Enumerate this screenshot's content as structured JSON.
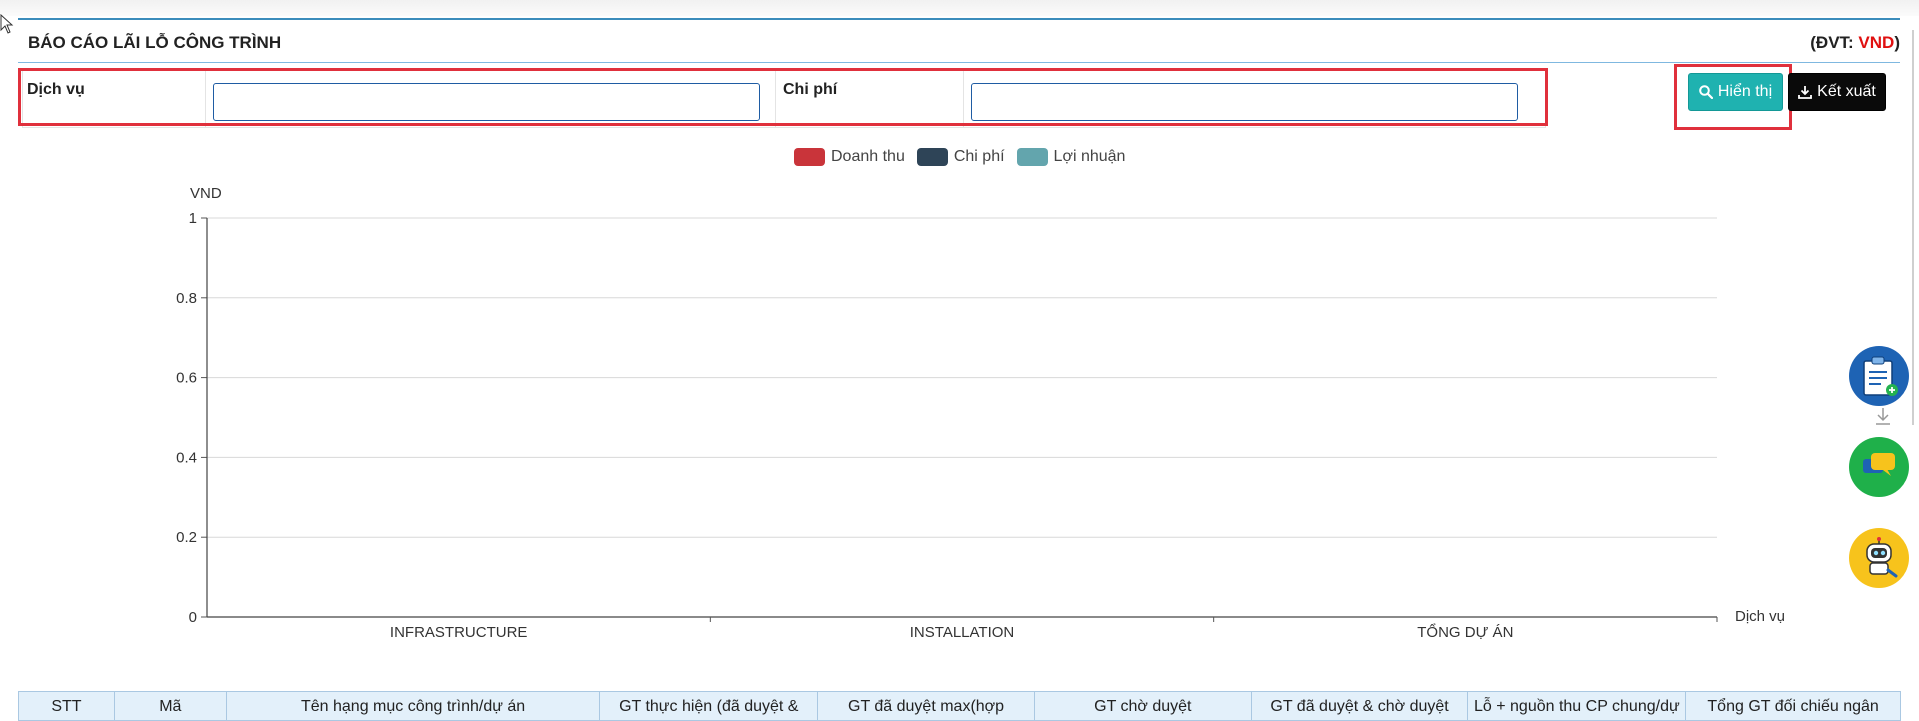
{
  "report": {
    "title": "BÁO CÁO LÃI LỖ CÔNG TRÌNH",
    "unit_prefix": "(ĐVT: ",
    "unit_value": "VND",
    "unit_suffix": ")"
  },
  "filters": {
    "service_label": "Dịch vụ",
    "service_value": "",
    "cost_label": "Chi phí",
    "cost_value": ""
  },
  "buttons": {
    "show_label": "Hiển thị",
    "export_label": "Kết xuất"
  },
  "legend": [
    {
      "name": "Doanh thu",
      "color": "#c9343a"
    },
    {
      "name": "Chi phí",
      "color": "#2e4457"
    },
    {
      "name": "Lợi nhuận",
      "color": "#63a5ad"
    }
  ],
  "chart_data": {
    "type": "bar",
    "categories": [
      "INFRASTRUCTURE",
      "INSTALLATION",
      "TỔNG DỰ ÁN"
    ],
    "series": [
      {
        "name": "Doanh thu",
        "values": [
          0,
          0,
          0
        ]
      },
      {
        "name": "Chi phí",
        "values": [
          0,
          0,
          0
        ]
      },
      {
        "name": "Lợi nhuận",
        "values": [
          0,
          0,
          0
        ]
      }
    ],
    "xlabel": "Dịch vụ",
    "ylabel": "VND",
    "ylim": [
      0,
      1
    ],
    "yticks": [
      "0",
      "0.2",
      "0.4",
      "0.6",
      "0.8",
      "1"
    ],
    "grid": true,
    "legend_position": "top-center"
  },
  "table": {
    "headers": [
      "STT",
      "Mã",
      "Tên hạng mục công trình/dự án",
      "GT thực hiện (đã duyệt &",
      "GT đã duyệt max(hợp",
      "GT chờ duyệt",
      "GT đã duyệt & chờ duyệt",
      "Lỗ + nguồn thu CP chung/dự",
      "Tổng GT đối chiếu ngân"
    ]
  },
  "floating": {
    "clipboard_icon_color": "#1e63b4",
    "chat_icon_color": "#1fb04a",
    "bot_icon_color": "#f7c31c"
  }
}
